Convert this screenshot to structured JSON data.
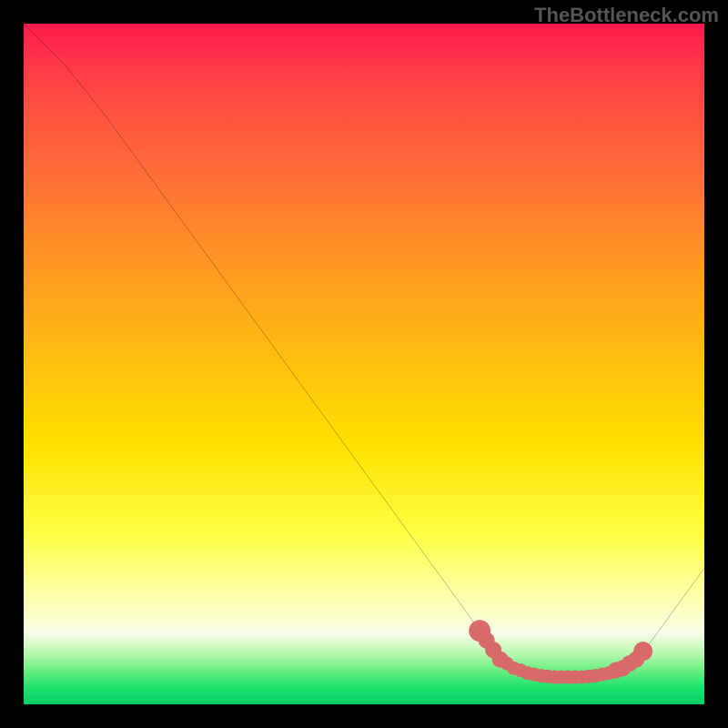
{
  "watermark": "TheBottleneck.com",
  "chart_data": {
    "type": "line",
    "title": "",
    "xlabel": "",
    "ylabel": "",
    "xlim": [
      0,
      100
    ],
    "ylim": [
      0,
      100
    ],
    "grid": false,
    "curve": [
      {
        "x": 0,
        "y": 100
      },
      {
        "x": 6,
        "y": 94
      },
      {
        "x": 12,
        "y": 86.5
      },
      {
        "x": 64,
        "y": 15
      },
      {
        "x": 67,
        "y": 10.8
      },
      {
        "x": 70,
        "y": 6.6
      },
      {
        "x": 72,
        "y": 5.3
      },
      {
        "x": 74,
        "y": 4.6
      },
      {
        "x": 76,
        "y": 4.2
      },
      {
        "x": 78,
        "y": 4.0
      },
      {
        "x": 80,
        "y": 4.0
      },
      {
        "x": 82,
        "y": 4.0
      },
      {
        "x": 84,
        "y": 4.2
      },
      {
        "x": 86,
        "y": 4.6
      },
      {
        "x": 88,
        "y": 5.3
      },
      {
        "x": 90,
        "y": 6.6
      },
      {
        "x": 92,
        "y": 9.0
      },
      {
        "x": 100,
        "y": 20
      }
    ],
    "markers": [
      {
        "x": 67,
        "y": 10.8,
        "r": 1.6
      },
      {
        "x": 68,
        "y": 9.4,
        "r": 1.2
      },
      {
        "x": 69,
        "y": 8.0,
        "r": 1.2
      },
      {
        "x": 70,
        "y": 6.6,
        "r": 1.2
      },
      {
        "x": 71,
        "y": 6.0,
        "r": 1.0
      },
      {
        "x": 72,
        "y": 5.3,
        "r": 1.0
      },
      {
        "x": 73,
        "y": 5.0,
        "r": 1.0
      },
      {
        "x": 74,
        "y": 4.6,
        "r": 1.0
      },
      {
        "x": 75,
        "y": 4.4,
        "r": 1.0
      },
      {
        "x": 76,
        "y": 4.2,
        "r": 1.0
      },
      {
        "x": 77,
        "y": 4.1,
        "r": 1.0
      },
      {
        "x": 78,
        "y": 4.0,
        "r": 1.0
      },
      {
        "x": 79,
        "y": 4.0,
        "r": 1.0
      },
      {
        "x": 80,
        "y": 4.0,
        "r": 1.0
      },
      {
        "x": 81,
        "y": 4.0,
        "r": 1.0
      },
      {
        "x": 82,
        "y": 4.0,
        "r": 1.0
      },
      {
        "x": 83,
        "y": 4.1,
        "r": 1.0
      },
      {
        "x": 84,
        "y": 4.2,
        "r": 1.0
      },
      {
        "x": 85,
        "y": 4.4,
        "r": 1.0
      },
      {
        "x": 86,
        "y": 4.6,
        "r": 1.0
      },
      {
        "x": 87,
        "y": 5.0,
        "r": 1.2
      },
      {
        "x": 88,
        "y": 5.3,
        "r": 1.2
      },
      {
        "x": 89,
        "y": 6.0,
        "r": 1.2
      },
      {
        "x": 90,
        "y": 6.6,
        "r": 1.2
      },
      {
        "x": 91,
        "y": 7.8,
        "r": 1.4
      }
    ]
  }
}
